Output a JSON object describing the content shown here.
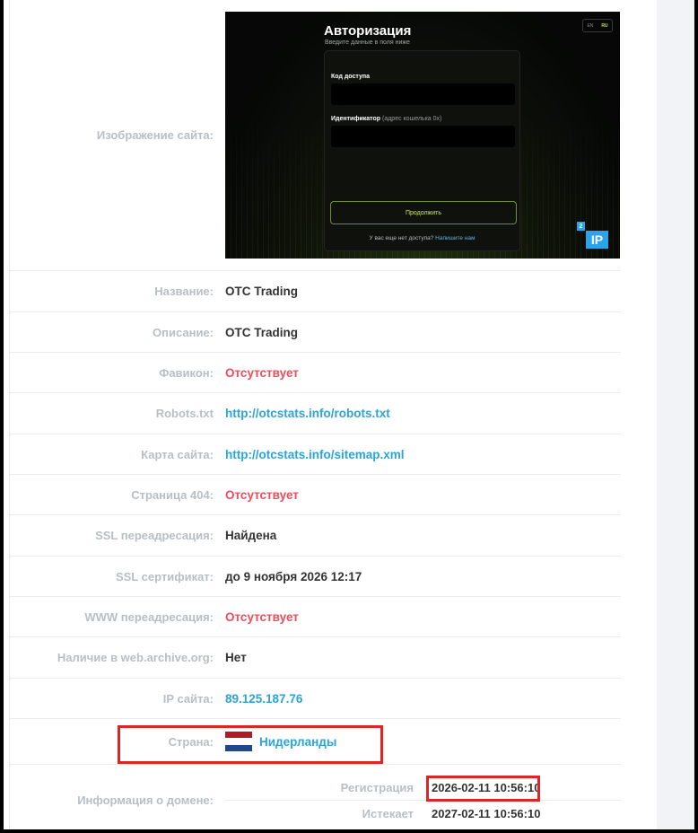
{
  "preview": {
    "label": "Изображение сайта:",
    "screenshot": {
      "title": "Авторизация",
      "subtitle": "Введите данные в поля ниже",
      "lang_en": "EN",
      "lang_ru": "RU",
      "field1_label": "Код доступа",
      "field2_label": "Идентификатор",
      "field2_hint": "(адрес кошелька 0x)",
      "button": "Продолжить",
      "footer_text": "У вас еще нет доступа?",
      "footer_link": "Напишите нам",
      "badge_num": "2",
      "badge_text": "IP"
    }
  },
  "rows": [
    {
      "label": "Название:",
      "value": "OTC Trading"
    },
    {
      "label": "Описание:",
      "value": "OTC Trading"
    },
    {
      "label": "Фавикон:",
      "value": "Отсутствует"
    },
    {
      "label": "Robots.txt",
      "value": "http://otcstats.info/robots.txt"
    },
    {
      "label": "Карта сайта:",
      "value": "http://otcstats.info/sitemap.xml"
    },
    {
      "label": "Страница 404:",
      "value": "Отсутствует"
    },
    {
      "label": "SSL переадресация:",
      "value": "Найдена"
    },
    {
      "label": "SSL сертификат:",
      "value": "до 9 ноября 2026 12:17"
    },
    {
      "label": "WWW переадресация:",
      "value": "Отсутствует"
    },
    {
      "label": "Наличие в web.archive.org:",
      "value": "Нет"
    },
    {
      "label": "IP сайта:",
      "value": "89.125.187.76"
    },
    {
      "label": "Страна:",
      "value": "Нидерланды"
    }
  ],
  "domain": {
    "label": "Информация о домене:",
    "registration_label": "Регистрация",
    "registration_value": "2026-02-11 10:56:10",
    "expires_label": "Истекает",
    "expires_value": "2027-02-11 10:56:10"
  },
  "colors": {
    "label": "#b9bec5",
    "missing": "#f04b5d",
    "link": "#2ea3d6",
    "highlight": "#e02424",
    "flag": [
      "#ae1c28",
      "#ffffff",
      "#21468b"
    ]
  }
}
